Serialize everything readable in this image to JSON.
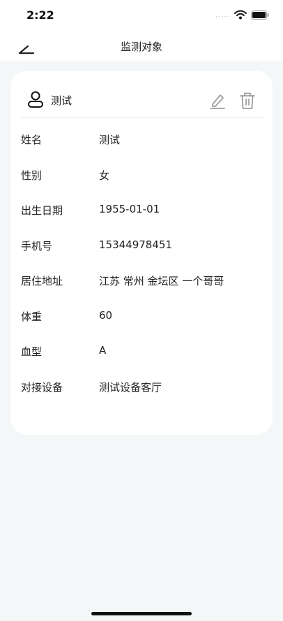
{
  "status_bar": {
    "time": "2:22",
    "signal": "....."
  },
  "nav": {
    "title": "监测对象"
  },
  "card": {
    "header_name": "测试",
    "rows": [
      {
        "label": "姓名",
        "value": "测试"
      },
      {
        "label": "性别",
        "value": "女"
      },
      {
        "label": "出生日期",
        "value": "1955-01-01"
      },
      {
        "label": "手机号",
        "value": "15344978451"
      },
      {
        "label": "居住地址",
        "value": "江苏 常州 金坛区 一个哥哥"
      },
      {
        "label": "体重",
        "value": "60"
      },
      {
        "label": "血型",
        "value": "A"
      },
      {
        "label": "对接设备",
        "value": "测试设备客厅"
      }
    ]
  },
  "colors": {
    "background": "#f3f7f8",
    "card": "#ffffff",
    "icon_gray": "#9e9e9e"
  },
  "icons": [
    "back-icon",
    "user-icon",
    "edit-icon",
    "trash-icon",
    "wifi-icon",
    "battery-icon"
  ]
}
